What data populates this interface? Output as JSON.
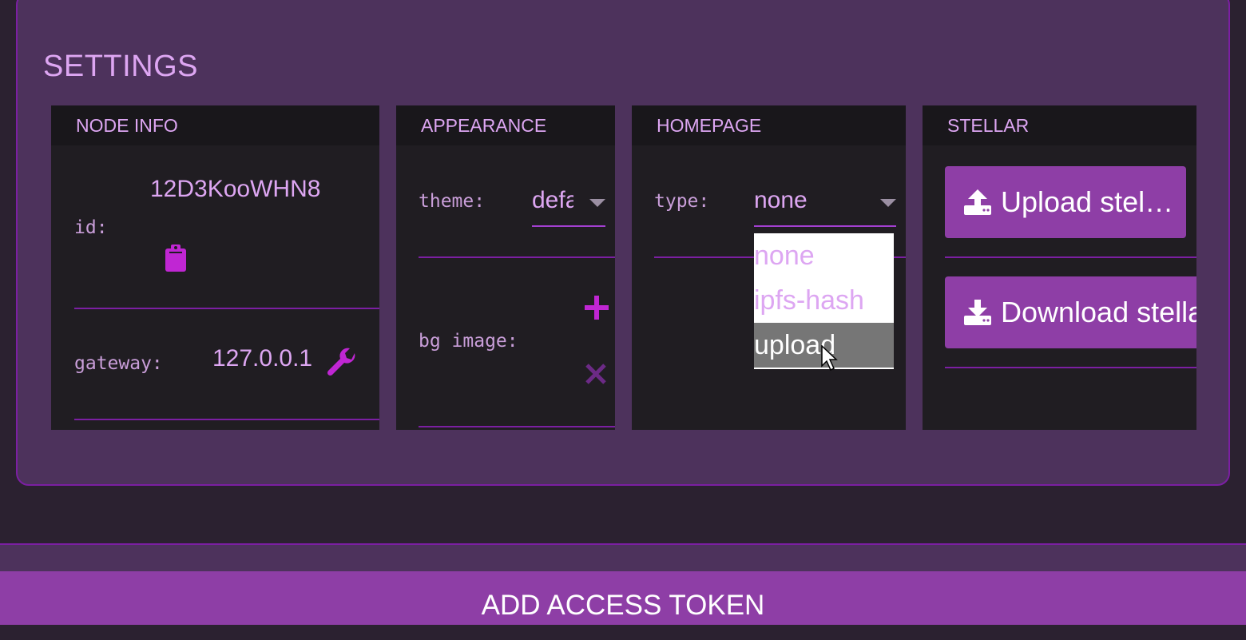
{
  "settings": {
    "title": "SETTINGS"
  },
  "node_info": {
    "header": "NODE INFO",
    "id_label": "id:",
    "id_value": "12D3KooWHN8",
    "gateway_label": "gateway:",
    "gateway_value": "127.0.0.1"
  },
  "appearance": {
    "header": "APPEARANCE",
    "theme_label": "theme:",
    "theme_value": "default",
    "bg_image_label": "bg image:"
  },
  "homepage": {
    "header": "HOMEPAGE",
    "type_label": "type:",
    "type_value": "none",
    "options": [
      "none",
      "ipfs-hash",
      "upload"
    ],
    "highlighted_option": "upload"
  },
  "stellar": {
    "header": "STELLAR",
    "upload_label": "Upload stel…",
    "download_label": "Download stella"
  },
  "footer": {
    "add_token_label": "ADD ACCESS TOKEN"
  },
  "colors": {
    "accent": "#8e3ea6",
    "accent_bright": "#c026d3",
    "card_bg": "#4d325c",
    "panel_bg": "#201d22",
    "text_light": "#dda6f2"
  },
  "icons": {
    "copy": "clipboard-icon",
    "gateway": "wrench-icon",
    "add": "plus-icon",
    "remove": "close-icon",
    "upload": "upload-icon",
    "download": "download-icon",
    "dropdown": "caret-down-icon"
  }
}
